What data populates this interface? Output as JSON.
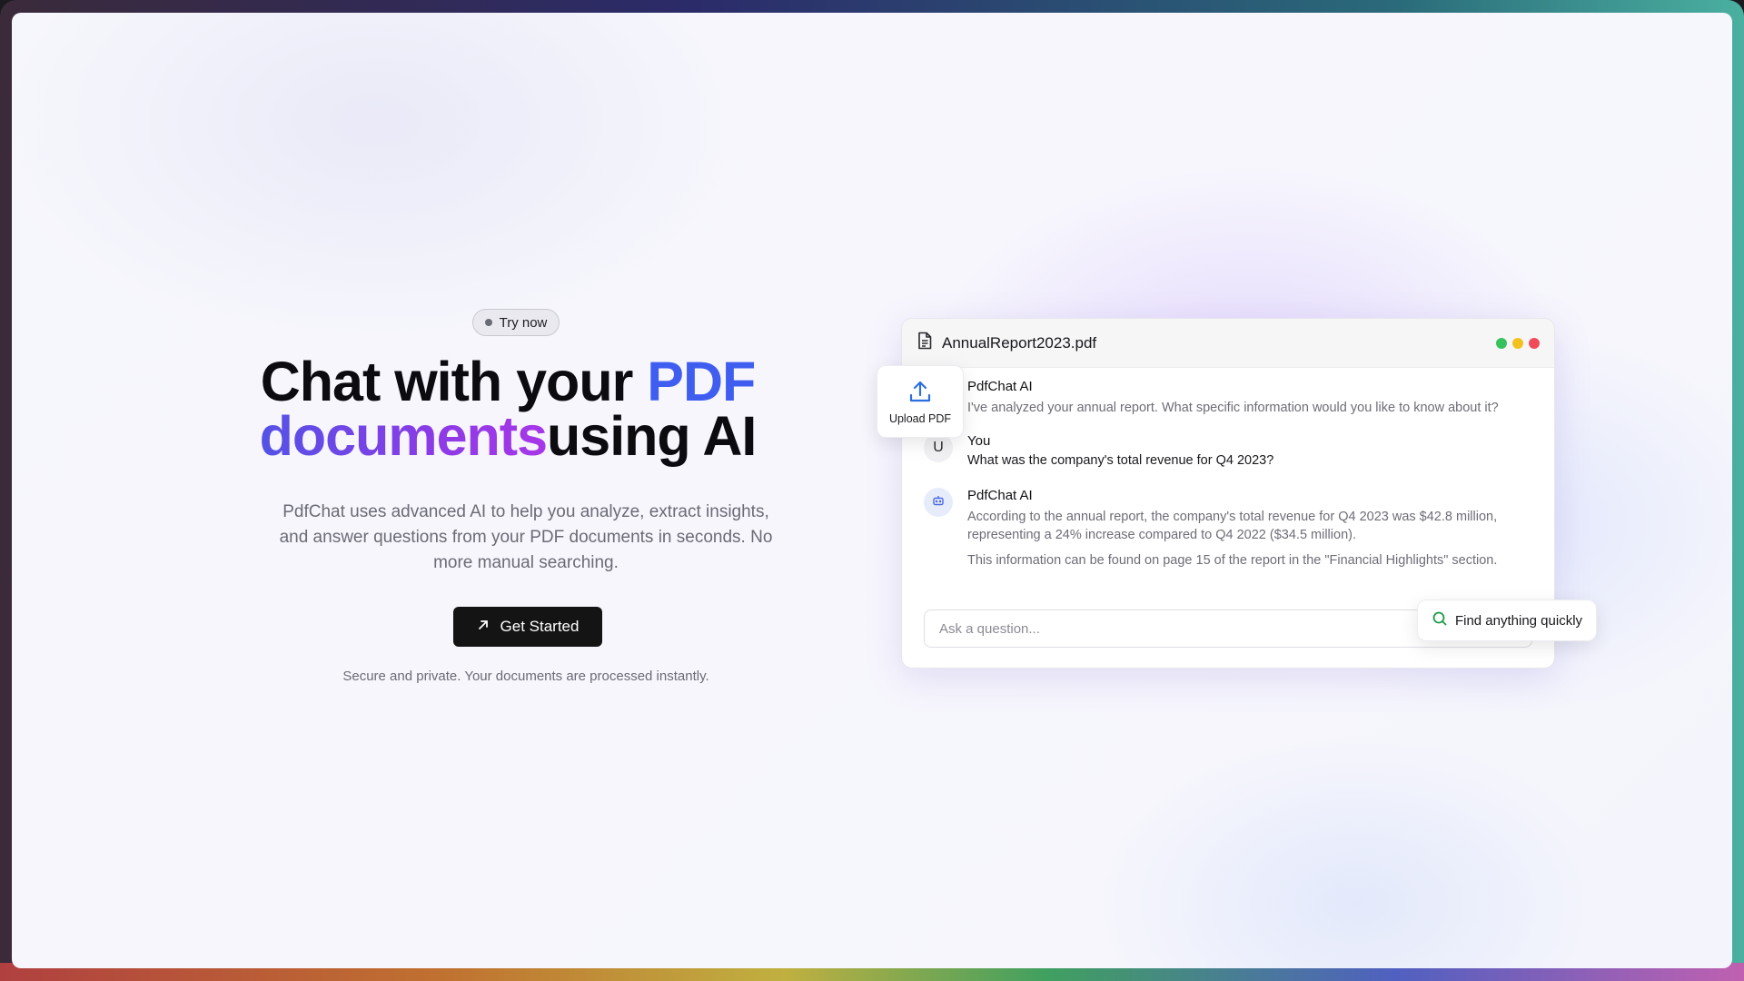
{
  "badge": {
    "label": "Try now"
  },
  "hero": {
    "title_part1": "Chat with your ",
    "title_highlight1": "PDF",
    "title_highlight2": "documents",
    "title_part2": "using AI",
    "subtitle": "PdfChat uses advanced AI to help you analyze, extract insights, and answer questions from your PDF documents in seconds. No more manual searching.",
    "cta_label": "Get Started",
    "footnote": "Secure and private. Your documents are processed instantly."
  },
  "chat": {
    "file_name": "AnnualReport2023.pdf",
    "window_dots": [
      "#35c25a",
      "#f2c11d",
      "#f04b5a"
    ],
    "messages": [
      {
        "sender": "PdfChat AI",
        "avatar_icon": "bot-icon",
        "lines": [
          "I've analyzed your annual report. What specific information would you like to know about it?"
        ]
      },
      {
        "sender": "You",
        "avatar_text": "U",
        "lines": [
          "What was the company's total revenue for Q4 2023?"
        ]
      },
      {
        "sender": "PdfChat AI",
        "avatar_icon": "bot-icon",
        "lines": [
          "According to the annual report, the company's total revenue for Q4 2023 was $42.8 million, representing a 24% increase compared to Q4 2022 ($34.5 million).",
          "This information can be found on page 15 of the report in the \"Financial Highlights\" section."
        ]
      }
    ],
    "input_placeholder": "Ask a question..."
  },
  "floating": {
    "upload_label": "Upload PDF",
    "find_label": "Find anything quickly"
  },
  "colors": {
    "accent_blue": "#3f5ef0",
    "accent_purple": "#a737e8",
    "cta_bg": "#141414",
    "find_icon": "#1f9a4a",
    "upload_icon": "#2b6fe0"
  }
}
